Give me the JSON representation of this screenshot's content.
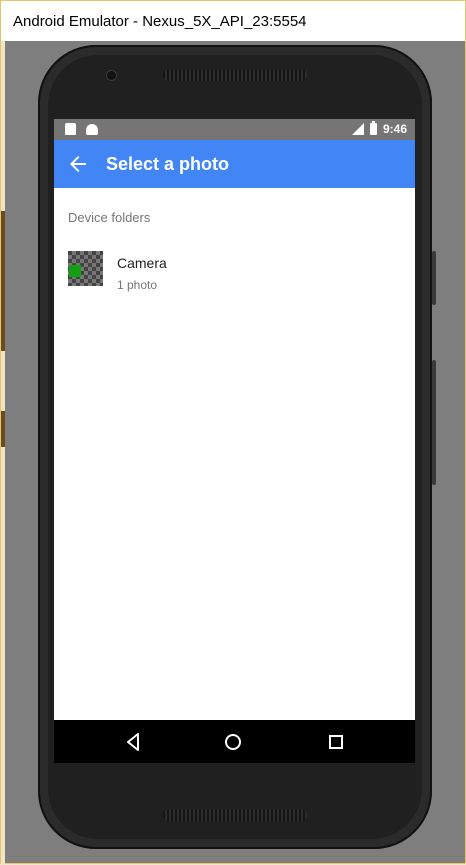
{
  "window": {
    "title": "Android Emulator - Nexus_5X_API_23:5554"
  },
  "status_bar": {
    "time": "9:46",
    "network": "LTE"
  },
  "app_bar": {
    "title": "Select a photo"
  },
  "section": {
    "header": "Device folders"
  },
  "folders": [
    {
      "name": "Camera",
      "count": "1 photo"
    }
  ],
  "colors": {
    "app_bar": "#4285f4",
    "status_bar": "#757575",
    "nav_bar": "#000000"
  },
  "icons": {
    "back": "arrow-left-icon",
    "nav_back": "triangle-back-icon",
    "nav_home": "circle-home-icon",
    "nav_recent": "square-recents-icon"
  }
}
